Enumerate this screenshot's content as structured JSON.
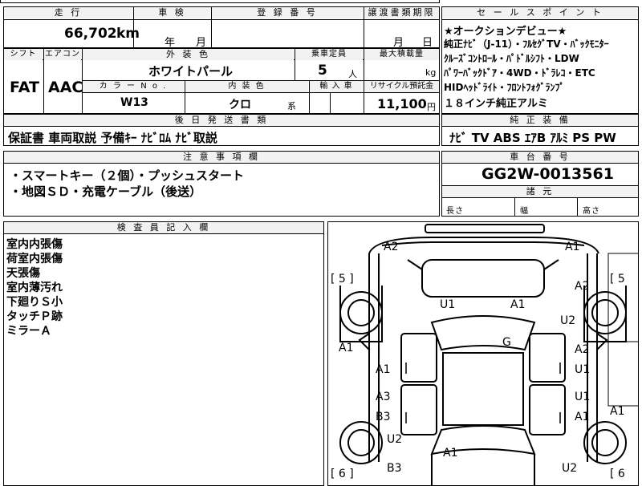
{
  "top": {
    "mileage_header": "走 行",
    "inspection_header": "車 検",
    "registration_header": "登 録 番 号",
    "transfer_header": "譲渡書類期限",
    "mileage": "66,702",
    "mileage_unit": "km",
    "inspection_year": "年",
    "inspection_month": "月",
    "transfer_month": "月",
    "transfer_day": "日"
  },
  "spec": {
    "shift_header": "シフト",
    "ac_header": "エアコン",
    "exterior_header": "外 装 色",
    "capacity_header": "乗車定員",
    "load_header": "最大積載量",
    "shift": "FAT",
    "ac": "AAC",
    "exterior": "ホワイトパール",
    "capacity": "5",
    "capacity_unit": "人",
    "load_unit": "kg",
    "color_no_header": "カ ラ ー N o .",
    "interior_header": "内 装 色",
    "import_header": "輸 入 車",
    "recycle_header": "リサイクル預託金",
    "color_no": "W13",
    "interior": "クロ",
    "interior_suffix": "系",
    "recycle": "11,100",
    "recycle_unit": "円"
  },
  "later": {
    "header": "後 日 発 送 書 類",
    "text": "保証書 車両取説 予備ｷｰ ﾅﾋﾞﾛﾑ ﾅﾋﾞ取説"
  },
  "notes": {
    "header": "注 意 事 項 欄",
    "lines": [
      "・スマートキー（２個）・プッシュスタート",
      "・地図ＳＤ・充電ケーブル（後送）"
    ]
  },
  "sales": {
    "header": "セ ー ル ス ポ イ ン ト",
    "lines": [
      "★オークションデビュー★",
      "純正ﾅﾋﾞ（J-11）・ﾌﾙｾｸﾞTV・ﾊﾞｯｸﾓﾆﾀｰ",
      "ｸﾙｰｽﾞｺﾝﾄﾛｰﾙ・ﾊﾟﾄﾞﾙｼﾌﾄ・LDW",
      "ﾊﾟﾜｰﾊﾞｯｸﾄﾞｱ・4WD・ﾄﾞﾗﾚｺ・ETC",
      "HIDﾍｯﾄﾞﾗｲﾄ・ﾌﾛﾝﾄﾌｫｸﾞﾗﾝﾌﾟ",
      "１８インチ純正アルミ"
    ]
  },
  "equipment": {
    "header": "純 正 装 備",
    "text": "ﾅﾋﾞ  TV  ABS  ｴｱB  ｱﾙﾐ  PS  PW"
  },
  "chassis": {
    "header": "車 台 番 号",
    "number": "GG2W-0013561",
    "dims_header": "諸 元",
    "length_label": "長さ",
    "width_label": "幅",
    "height_label": "高さ"
  },
  "inspector": {
    "header": "検 査 員 記 入 欄",
    "lines": [
      "室内内張傷",
      "荷室内張傷",
      "天張傷",
      "室内薄汚れ",
      "下廻りＳ小",
      "タッチＰ跡",
      "ミラーＡ"
    ]
  },
  "diagram": {
    "labels": {
      "a2_tl": "A2",
      "a1_tr": "A1",
      "b5_left": "[ 5 ]",
      "b5_right": "[ 5",
      "u1_front": "U1",
      "a1_front": "A1",
      "a2_right": "A2",
      "u2_right": "U2",
      "g_center": "G",
      "a1_left": "A1",
      "a2_rdoor": "A2",
      "a1_ldoor": "A1",
      "u1_rdoor": "U1",
      "a3_ldoor": "A3",
      "u1_rdoor2": "U1",
      "b3_ldoor": "B3",
      "a1_rdoor2": "A1",
      "a1_rightedge": "A1",
      "u2_left_rear": "U2",
      "a1_rear": "A1",
      "b3_rear": "B3",
      "u2_right_rear": "U2",
      "b6_left": "[ 6 ]",
      "b6_right": "[ 6"
    }
  }
}
